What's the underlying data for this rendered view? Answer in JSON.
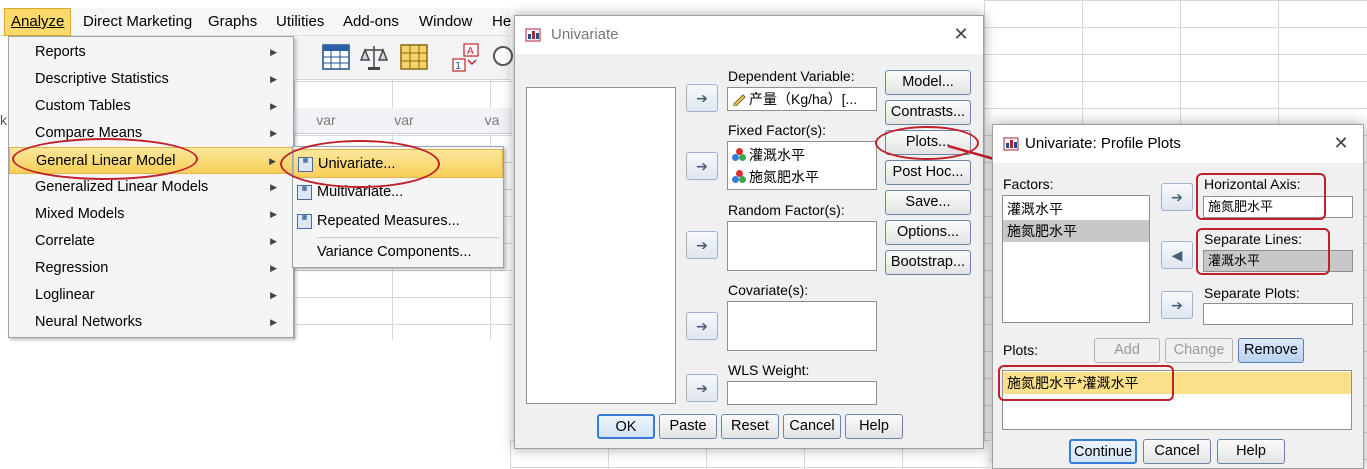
{
  "menubar": {
    "items": [
      {
        "label": "Analyze",
        "active": true
      },
      {
        "label": "Direct Marketing"
      },
      {
        "label": "Graphs"
      },
      {
        "label": "Utilities"
      },
      {
        "label": "Add-ons"
      },
      {
        "label": "Window"
      },
      {
        "label": "He"
      }
    ]
  },
  "data_editor": {
    "col_headers": [
      "var",
      "var",
      "va"
    ],
    "left_fragment": "k"
  },
  "analyze_menu": {
    "items": [
      {
        "label": "Reports"
      },
      {
        "label": "Descriptive Statistics"
      },
      {
        "label": "Custom Tables"
      },
      {
        "label": "Compare Means"
      },
      {
        "label": "General Linear Model",
        "highlighted": true
      },
      {
        "label": "Generalized Linear Models"
      },
      {
        "label": "Mixed Models"
      },
      {
        "label": "Correlate"
      },
      {
        "label": "Regression"
      },
      {
        "label": "Loglinear"
      },
      {
        "label": "Neural Networks"
      }
    ]
  },
  "glm_submenu": {
    "items": [
      {
        "label": "Univariate...",
        "highlighted": true
      },
      {
        "label": "Multivariate..."
      },
      {
        "label": "Repeated Measures..."
      },
      {
        "label": "Variance Components..."
      }
    ]
  },
  "univariate_dialog": {
    "title": "Univariate",
    "dependent_label": "Dependent Variable:",
    "dependent_value": "产量（Kg/ha）[...",
    "fixed_label": "Fixed Factor(s):",
    "fixed_values": [
      "灌溉水平",
      "施氮肥水平"
    ],
    "random_label": "Random Factor(s):",
    "covariate_label": "Covariate(s):",
    "wls_label": "WLS Weight:",
    "side_buttons": [
      "Model...",
      "Contrasts...",
      "Plots...",
      "Post Hoc...",
      "Save...",
      "Options...",
      "Bootstrap..."
    ],
    "bottom_buttons": [
      "OK",
      "Paste",
      "Reset",
      "Cancel",
      "Help"
    ]
  },
  "profile_dialog": {
    "title": "Univariate: Profile Plots",
    "factors_label": "Factors:",
    "factors": [
      "灌溉水平",
      "施氮肥水平"
    ],
    "horizontal_label": "Horizontal Axis:",
    "horizontal_value": "施氮肥水平",
    "separate_lines_label": "Separate Lines:",
    "separate_lines_value": "灌溉水平",
    "separate_plots_label": "Separate Plots:",
    "plots_label": "Plots:",
    "add_label": "Add",
    "change_label": "Change",
    "remove_label": "Remove",
    "plot_item": "施氮肥水平*灌溉水平",
    "bottom_buttons": [
      "Continue",
      "Cancel",
      "Help"
    ]
  },
  "colors": {
    "highlight": "#f7cf58",
    "annotation_red": "#c0202a",
    "dialog_bg": "#f0f0f0"
  }
}
